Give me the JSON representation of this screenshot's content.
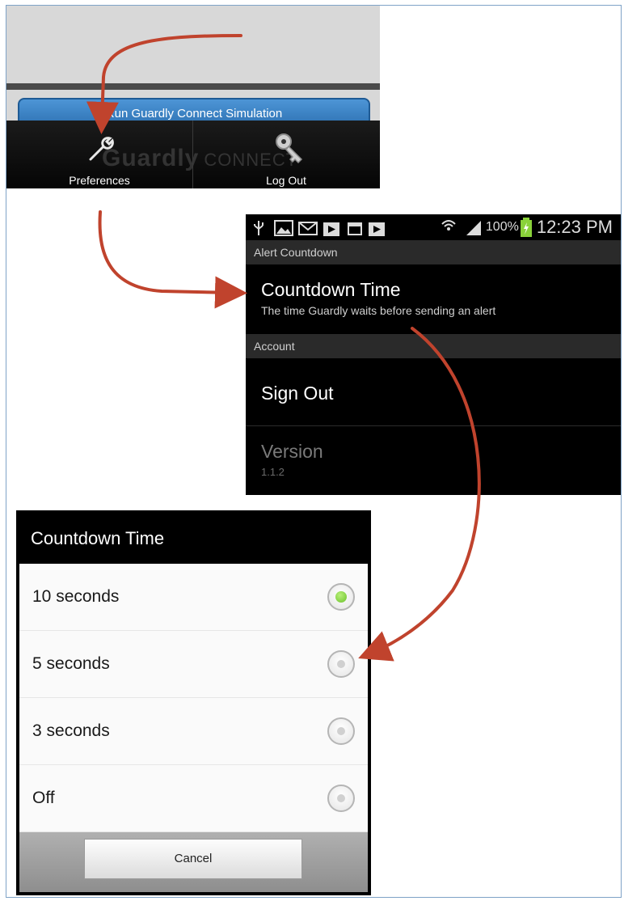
{
  "menu_screen": {
    "sim_button_label": "Run Guardly Connect Simulation",
    "watermark_brand": "Guardly",
    "watermark_suffix": "CONNECT",
    "items": [
      {
        "label": "Preferences",
        "icon": "wrench-icon"
      },
      {
        "label": "Log Out",
        "icon": "key-icon"
      }
    ]
  },
  "preferences_screen": {
    "status_bar": {
      "icons": [
        "usb-icon",
        "image-icon",
        "mail-icon",
        "play-store-icon",
        "calendar-icon",
        "play-store-icon"
      ],
      "battery_percent": "100%",
      "time": "12:23 PM"
    },
    "sections": [
      {
        "header": "Alert Countdown",
        "items": [
          {
            "title": "Countdown Time",
            "subtitle": "The time Guardly waits before sending an alert",
            "enabled": true
          }
        ]
      },
      {
        "header": "Account",
        "items": [
          {
            "title": "Sign Out",
            "enabled": true
          },
          {
            "title": "Version",
            "subtitle": "1.1.2",
            "enabled": false
          }
        ]
      }
    ]
  },
  "countdown_dialog": {
    "title": "Countdown Time",
    "options": [
      {
        "label": "10 seconds",
        "selected": true
      },
      {
        "label": "5 seconds",
        "selected": false
      },
      {
        "label": "3 seconds",
        "selected": false
      },
      {
        "label": "Off",
        "selected": false
      }
    ],
    "cancel_label": "Cancel"
  },
  "colors": {
    "arrow": "#c0432d",
    "radio_selected": "#6bc12a",
    "sim_button": "#2f78bd"
  }
}
